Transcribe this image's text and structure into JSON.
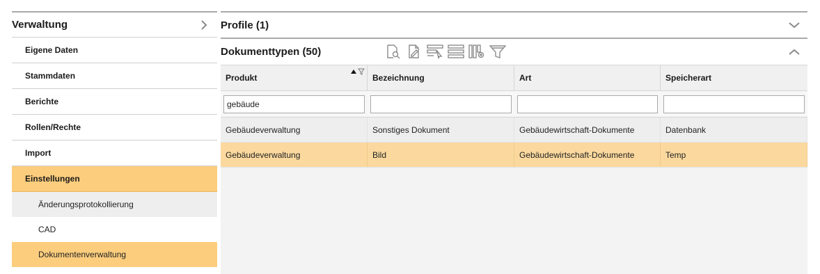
{
  "sidebar": {
    "title": "Verwaltung",
    "items": [
      {
        "label": "Eigene Daten"
      },
      {
        "label": "Stammdaten"
      },
      {
        "label": "Berichte"
      },
      {
        "label": "Rollen/Rechte"
      },
      {
        "label": "Import"
      },
      {
        "label": "Einstellungen",
        "active": true
      }
    ],
    "subitems": [
      {
        "label": "Änderungsprotokollierung"
      },
      {
        "label": "CAD"
      },
      {
        "label": "Dokumentenverwaltung",
        "active": true
      }
    ]
  },
  "main": {
    "profile_title": "Profile (1)",
    "doctypes_title": "Dokumenttypen (50)",
    "toolbar_icons": [
      "document-search-icon",
      "document-edit-icon",
      "row-select-icon",
      "list-icon",
      "column-settings-icon",
      "filter-icon"
    ],
    "table": {
      "columns": [
        "Produkt",
        "Bezeichnung",
        "Art",
        "Speicherart"
      ],
      "filters": [
        "gebäude",
        "",
        "",
        ""
      ],
      "rows": [
        [
          "Gebäudeverwaltung",
          "Sonstiges Dokument",
          "Gebäudewirtschaft-Dokumente",
          "Datenbank"
        ],
        [
          "Gebäudeverwaltung",
          "Bild",
          "Gebäudewirtschaft-Dokumente",
          "Temp"
        ]
      ]
    }
  },
  "colors": {
    "accent": "#fccd7d",
    "row_selected": "#fbd99e"
  }
}
